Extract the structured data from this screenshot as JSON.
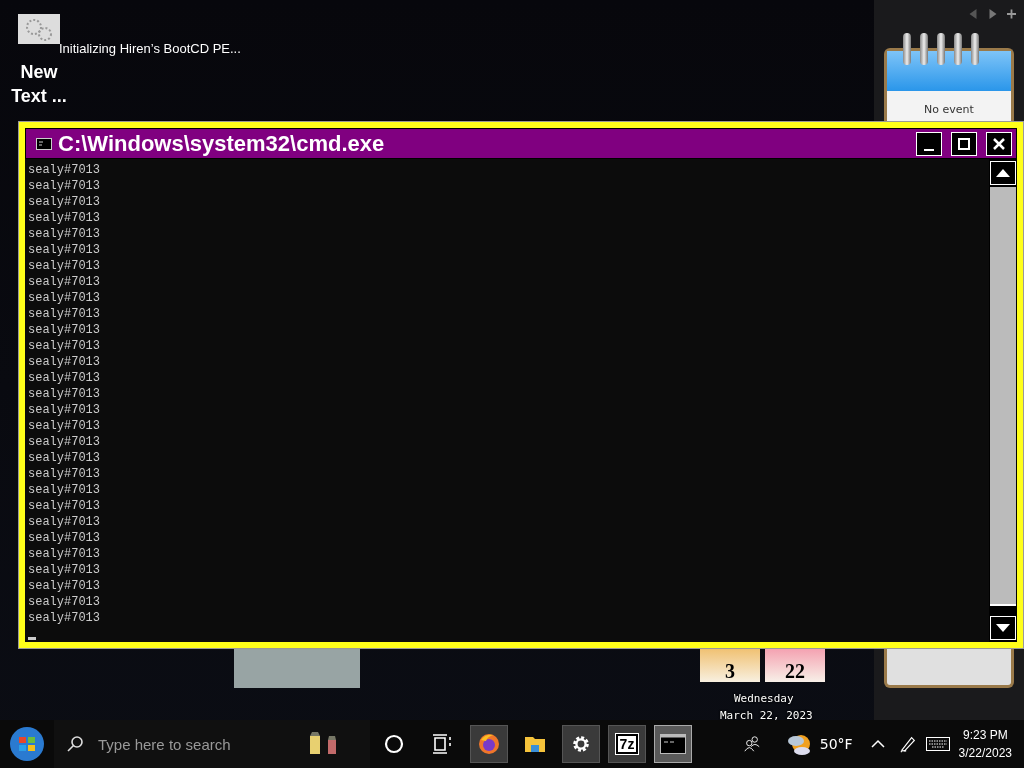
{
  "desktop_icon": {
    "label": "New Text ..."
  },
  "notification": {
    "text": "Initializing Hiren’s BootCD PE..."
  },
  "notes_gadget": {
    "text": "No event"
  },
  "calendar_gadget": {
    "month_number": "3",
    "day_number": "22",
    "weekday": "Wednesday",
    "date": "March 22, 2023"
  },
  "console_window": {
    "title": "C:\\Windows\\system32\\cmd.exe",
    "lines": [
      "sealy#7013",
      "sealy#7013",
      "sealy#7013",
      "sealy#7013",
      "sealy#7013",
      "sealy#7013",
      "sealy#7013",
      "sealy#7013",
      "sealy#7013",
      "sealy#7013",
      "sealy#7013",
      "sealy#7013",
      "sealy#7013",
      "sealy#7013",
      "sealy#7013",
      "sealy#7013",
      "sealy#7013",
      "sealy#7013",
      "sealy#7013",
      "sealy#7013",
      "sealy#7013",
      "sealy#7013",
      "sealy#7013",
      "sealy#7013",
      "sealy#7013",
      "sealy#7013",
      "sealy#7013",
      "sealy#7013",
      "sealy#7013"
    ]
  },
  "taskbar": {
    "search": {
      "placeholder": "Type here to search"
    },
    "apps": [
      {
        "kind": "browser",
        "running": true,
        "selected": false
      },
      {
        "kind": "folder",
        "running": false,
        "selected": false
      },
      {
        "kind": "settings",
        "running": true,
        "selected": false
      },
      {
        "kind": "archiver",
        "label": "7z",
        "running": true,
        "selected": false
      },
      {
        "kind": "console",
        "running": true,
        "selected": true
      }
    ],
    "weather": "50°F",
    "time": "9:23 PM",
    "date": "3/22/2023"
  }
}
